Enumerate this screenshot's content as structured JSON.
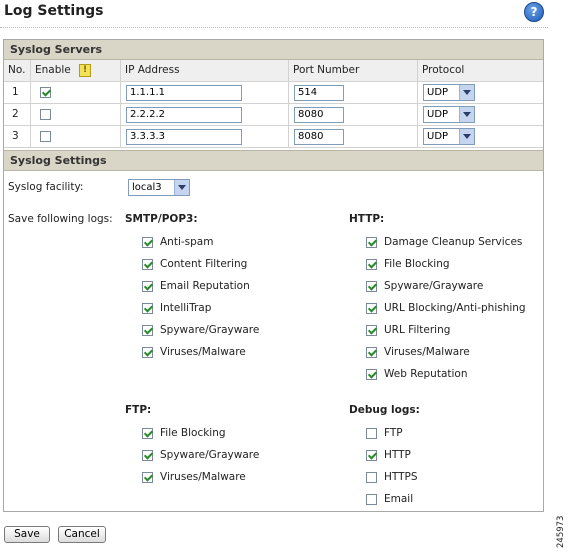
{
  "page": {
    "title": "Log Settings",
    "help_icon": "help-icon",
    "side_code": "245973"
  },
  "syslog_servers": {
    "heading": "Syslog Servers",
    "columns": [
      "No.",
      "Enable",
      "IP Address",
      "Port Number",
      "Protocol"
    ],
    "rows": [
      {
        "no": "1",
        "enabled": true,
        "ip": "1.1.1.1",
        "port": "514",
        "protocol": "UDP"
      },
      {
        "no": "2",
        "enabled": false,
        "ip": "2.2.2.2",
        "port": "8080",
        "protocol": "UDP"
      },
      {
        "no": "3",
        "enabled": false,
        "ip": "3.3.3.3",
        "port": "8080",
        "protocol": "UDP"
      }
    ]
  },
  "syslog_settings": {
    "heading": "Syslog Settings",
    "facility_label": "Syslog facility:",
    "facility_value": "local3",
    "save_logs_label": "Save following logs:",
    "groups": {
      "smtp": {
        "title": "SMTP/POP3:",
        "items": [
          {
            "label": "Anti-spam",
            "checked": true
          },
          {
            "label": "Content Filtering",
            "checked": true
          },
          {
            "label": "Email Reputation",
            "checked": true
          },
          {
            "label": "IntelliTrap",
            "checked": true
          },
          {
            "label": "Spyware/Grayware",
            "checked": true
          },
          {
            "label": "Viruses/Malware",
            "checked": true
          }
        ]
      },
      "http": {
        "title": "HTTP:",
        "items": [
          {
            "label": "Damage Cleanup Services",
            "checked": true
          },
          {
            "label": "File Blocking",
            "checked": true
          },
          {
            "label": "Spyware/Grayware",
            "checked": true
          },
          {
            "label": "URL Blocking/Anti-phishing",
            "checked": true
          },
          {
            "label": "URL Filtering",
            "checked": true
          },
          {
            "label": "Viruses/Malware",
            "checked": true
          },
          {
            "label": "Web Reputation",
            "checked": true
          }
        ]
      },
      "ftp": {
        "title": "FTP:",
        "items": [
          {
            "label": "File Blocking",
            "checked": true
          },
          {
            "label": "Spyware/Grayware",
            "checked": true
          },
          {
            "label": "Viruses/Malware",
            "checked": true
          }
        ]
      },
      "debug": {
        "title": "Debug logs:",
        "items": [
          {
            "label": "FTP",
            "checked": false
          },
          {
            "label": "HTTP",
            "checked": true
          },
          {
            "label": "HTTPS",
            "checked": false
          },
          {
            "label": "Email",
            "checked": false
          }
        ]
      }
    }
  },
  "buttons": {
    "save": "Save",
    "cancel": "Cancel"
  },
  "colors": {
    "section_header": "#d9d6c7",
    "check": "#2a8a2a",
    "input_border": "#7f9db9"
  }
}
